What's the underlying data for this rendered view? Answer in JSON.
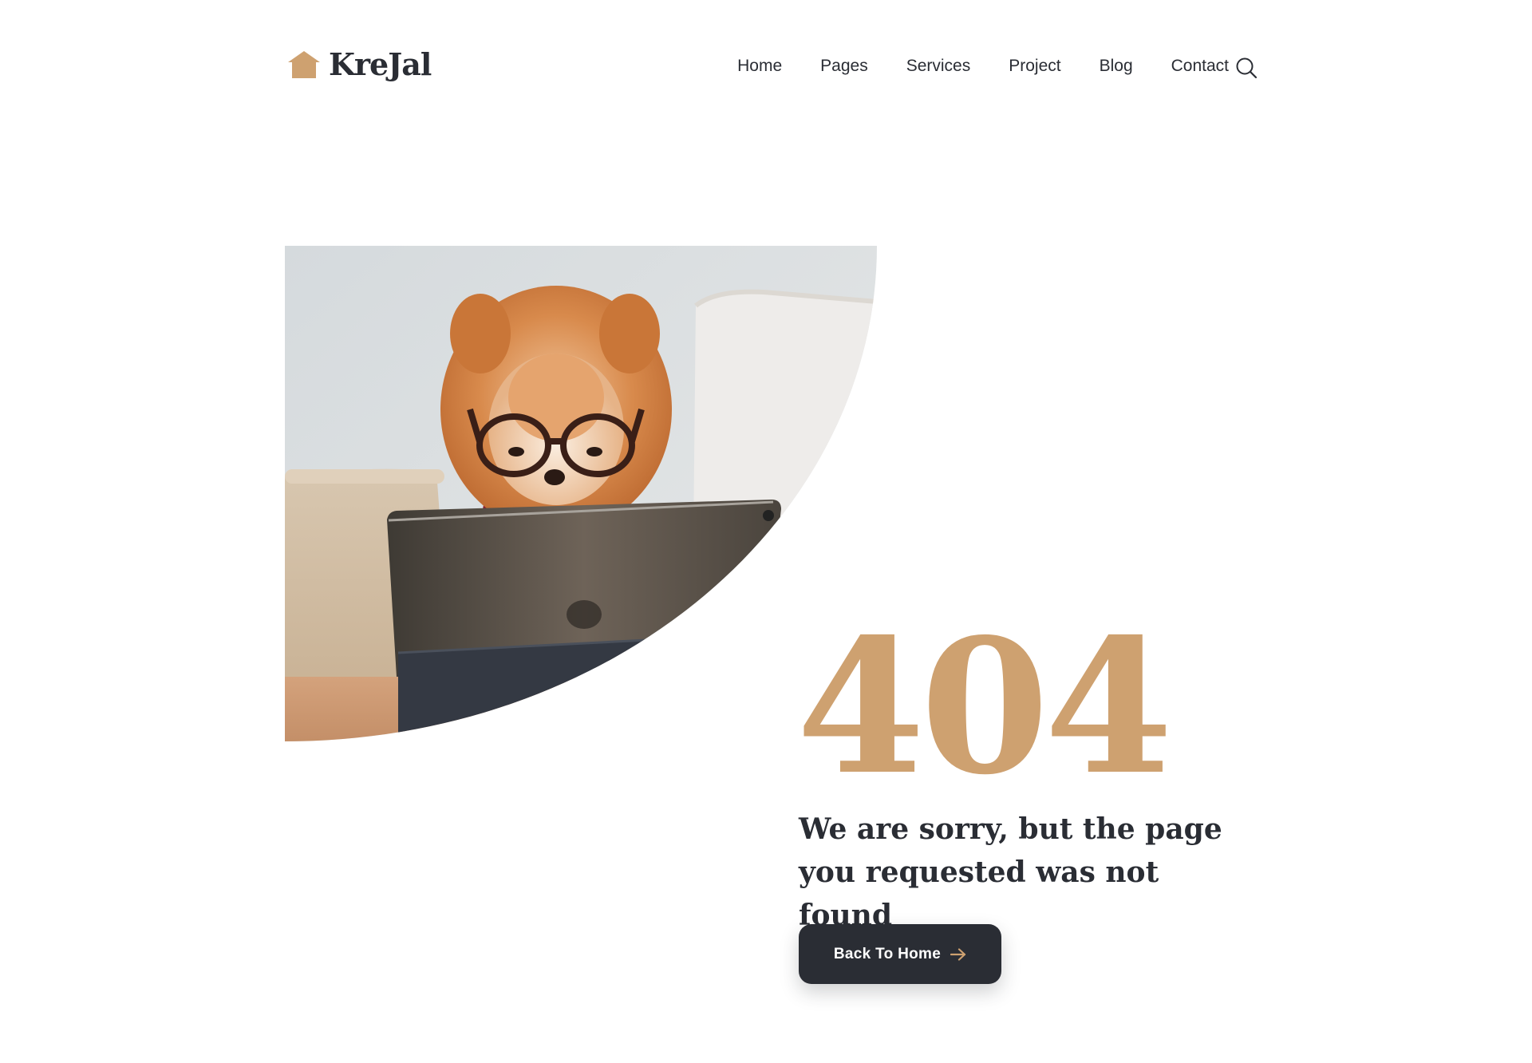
{
  "brand": {
    "name": "KreJal",
    "accent_color": "#cea170",
    "logo_icon": "house-icon"
  },
  "nav": {
    "items": [
      {
        "label": "Home"
      },
      {
        "label": "Pages"
      },
      {
        "label": "Services"
      },
      {
        "label": "Project"
      },
      {
        "label": "Blog"
      },
      {
        "label": "Contact"
      }
    ],
    "search_icon": "search-icon"
  },
  "hero": {
    "image_subject": "pomeranian-dog-with-glasses-tablet"
  },
  "error": {
    "code": "404",
    "message": "We are sorry, but the page  you requested was not found",
    "button_label": "Back To Home",
    "button_icon": "arrow-right-icon",
    "code_color": "#cea170",
    "button_color": "#2a2d34"
  }
}
